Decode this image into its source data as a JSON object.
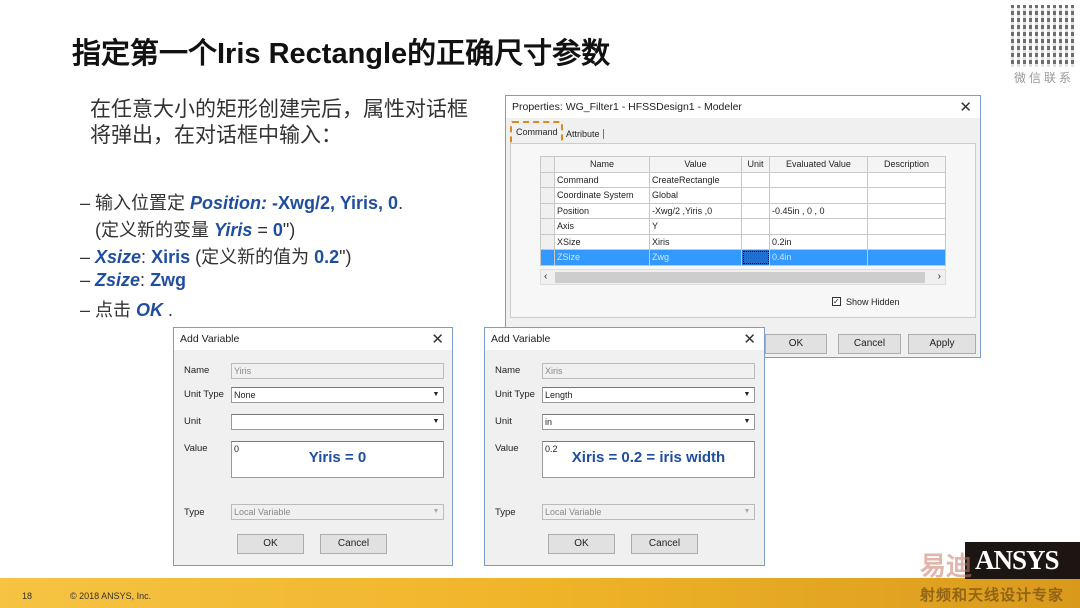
{
  "title": "指定第一个Iris Rectangle的正确尺寸参数",
  "qr_label": "微信联系",
  "intro": "在任意大小的矩形创建完后，属性对话框将弹出，在对话框中输入：",
  "bullets": {
    "b1_prefix": "– 输入位置定 ",
    "b1_key": "Position:",
    "b1_val": " -Xwg/2, Yiris, 0",
    ".": ".",
    "b1_end": ".",
    "b2_prefix": "(定义新的变量 ",
    "b2_key": "Yiris",
    "b2_eq": " = ",
    "b2_val": "0",
    "b2_end": "\")",
    "b3_prefix": "– ",
    "b3_key": "Xsize",
    "b3_colon": ": ",
    "b3_val": "Xiris",
    "b3_mid": " (定义新的值为 ",
    "b3_num": "0.2",
    "b3_end": "\")",
    "b4_prefix": "– ",
    "b4_key": "Zsize",
    "b4_colon": ":  ",
    "b4_val": "Zwg",
    "b5_prefix": "– 点击 ",
    "b5_key": "OK",
    "b5_end": " ."
  },
  "props": {
    "title": "Properties: WG_Filter1 - HFSSDesign1 - Modeler",
    "tabs": [
      "Command",
      "Attribute"
    ],
    "headers": [
      "Name",
      "Value",
      "Unit",
      "Evaluated Value",
      "Description"
    ],
    "rows": [
      [
        "Command",
        "CreateRectangle",
        "",
        "",
        ""
      ],
      [
        "Coordinate System",
        "Global",
        "",
        "",
        ""
      ],
      [
        "Position",
        "-Xwg/2 ,Yiris ,0",
        "",
        "-0.45in , 0 , 0",
        ""
      ],
      [
        "Axis",
        "Y",
        "",
        "",
        ""
      ],
      [
        "XSize",
        "Xiris",
        "",
        "0.2in",
        ""
      ],
      [
        "ZSize",
        "Zwg",
        "",
        "0.4in",
        ""
      ]
    ],
    "show_hidden": "Show Hidden",
    "ok": "OK",
    "cancel": "Cancel",
    "apply": "Apply"
  },
  "addvar": [
    {
      "title": "Add Variable",
      "name_label": "Name",
      "name": "Yiris",
      "unit_type_label": "Unit Type",
      "unit_type": "None",
      "unit_label": "Unit",
      "unit": "",
      "value_label": "Value",
      "value": "0",
      "annotation": "Yiris = 0",
      "type_label": "Type",
      "type": "Local Variable",
      "ok": "OK",
      "cancel": "Cancel"
    },
    {
      "title": "Add Variable",
      "name_label": "Name",
      "name": "Xiris",
      "unit_type_label": "Unit Type",
      "unit_type": "Length",
      "unit_label": "Unit",
      "unit": "in",
      "value_label": "Value",
      "value": "0.2",
      "annotation": "Xiris = 0.2 = iris width",
      "type_label": "Type",
      "type": "Local Variable",
      "ok": "OK",
      "cancel": "Cancel"
    }
  ],
  "footer": {
    "page": "18",
    "copyright": "© 2018 ANSYS, Inc.",
    "logo": "ANSYS",
    "watermark_top": "易迪",
    "watermark_bottom": "射频和天线设计专家"
  }
}
